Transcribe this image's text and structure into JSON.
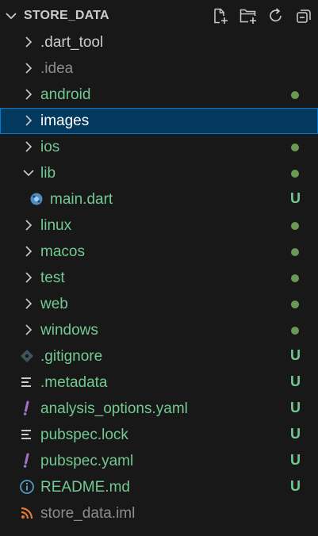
{
  "colors": {
    "background": "#181818",
    "default_text": "#cccccc",
    "dimmed_text": "#8c8c8c",
    "git_untracked": "#73c991",
    "git_modified_dot": "#6a9955",
    "selected_bg": "#04395e",
    "selected_border": "#0078d4"
  },
  "explorer": {
    "title": "STORE_DATA",
    "actions": [
      "new-file-icon",
      "new-folder-icon",
      "refresh-icon",
      "collapse-all-icon"
    ]
  },
  "tree": [
    {
      "label": ".dart_tool",
      "type": "folder",
      "expanded": false,
      "color": "#cccccc"
    },
    {
      "label": ".idea",
      "type": "folder",
      "expanded": false,
      "color": "#8c8c8c"
    },
    {
      "label": "android",
      "type": "folder",
      "expanded": false,
      "color": "#73c991",
      "badge": "dot"
    },
    {
      "label": "images",
      "type": "folder",
      "expanded": false,
      "color": "#ffffff",
      "selected": true
    },
    {
      "label": "ios",
      "type": "folder",
      "expanded": false,
      "color": "#73c991",
      "badge": "dot"
    },
    {
      "label": "lib",
      "type": "folder",
      "expanded": true,
      "color": "#73c991",
      "badge": "dot"
    },
    {
      "label": "main.dart",
      "type": "file",
      "icon": "dart-icon",
      "color": "#73c991",
      "badge": "U"
    },
    {
      "label": "linux",
      "type": "folder",
      "expanded": false,
      "color": "#73c991",
      "badge": "dot"
    },
    {
      "label": "macos",
      "type": "folder",
      "expanded": false,
      "color": "#73c991",
      "badge": "dot"
    },
    {
      "label": "test",
      "type": "folder",
      "expanded": false,
      "color": "#73c991",
      "badge": "dot"
    },
    {
      "label": "web",
      "type": "folder",
      "expanded": false,
      "color": "#73c991",
      "badge": "dot"
    },
    {
      "label": "windows",
      "type": "folder",
      "expanded": false,
      "color": "#73c991",
      "badge": "dot"
    },
    {
      "label": ".gitignore",
      "type": "file",
      "icon": "git-icon",
      "color": "#73c991",
      "badge": "U"
    },
    {
      "label": ".metadata",
      "type": "file",
      "icon": "lines-icon",
      "color": "#73c991",
      "badge": "U"
    },
    {
      "label": "analysis_options.yaml",
      "type": "file",
      "icon": "yaml-icon",
      "color": "#73c991",
      "badge": "U"
    },
    {
      "label": "pubspec.lock",
      "type": "file",
      "icon": "lines-icon",
      "color": "#73c991",
      "badge": "U"
    },
    {
      "label": "pubspec.yaml",
      "type": "file",
      "icon": "yaml-icon",
      "color": "#73c991",
      "badge": "U"
    },
    {
      "label": "README.md",
      "type": "file",
      "icon": "info-icon",
      "color": "#73c991",
      "badge": "U"
    },
    {
      "label": "store_data.iml",
      "type": "file",
      "icon": "rss-icon",
      "color": "#8c8c8c"
    }
  ]
}
